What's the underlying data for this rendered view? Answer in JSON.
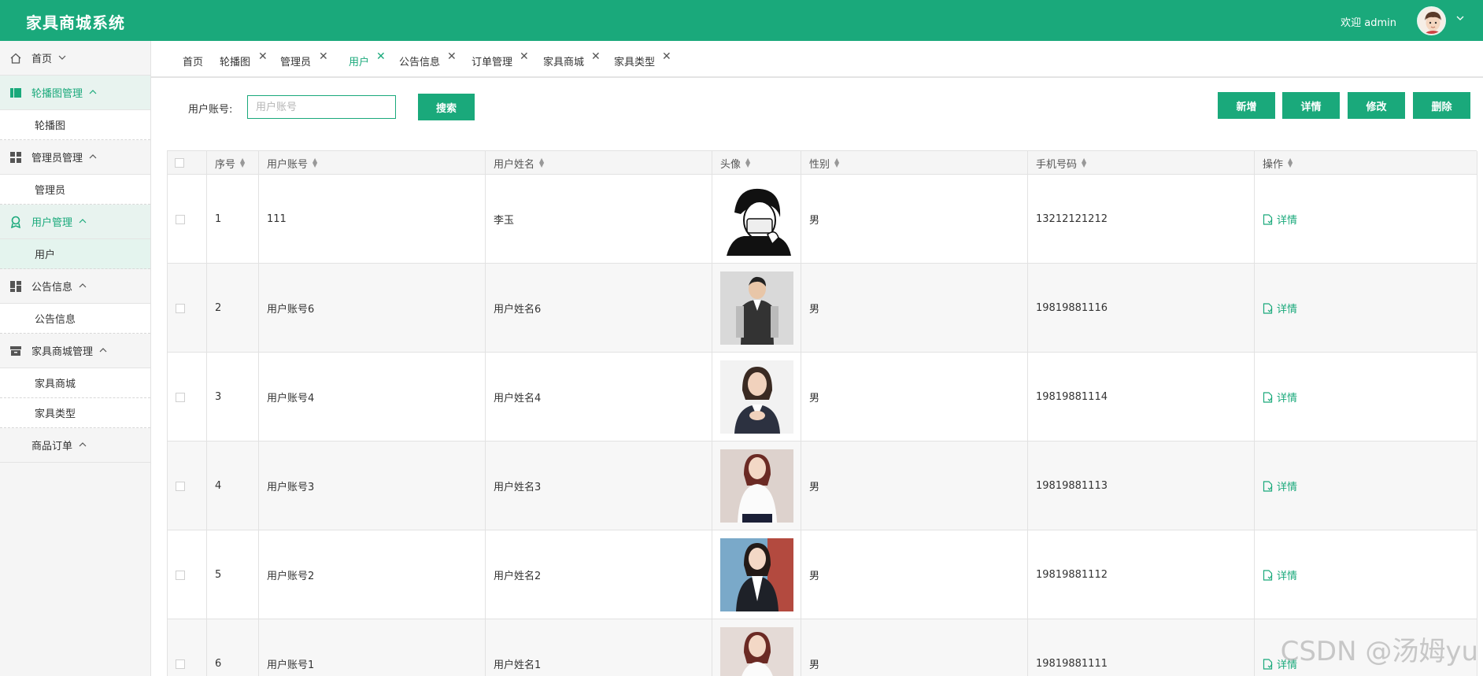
{
  "header": {
    "app_title": "家具商城系统",
    "welcome": "欢迎 admin",
    "accent_color": "#1aa97b"
  },
  "sidebar": {
    "home": "首页",
    "groups": [
      {
        "label": "轮播图管理",
        "icon": "carousel-icon",
        "subs": [
          "轮播图"
        ]
      },
      {
        "label": "管理员管理",
        "icon": "grid-icon",
        "subs": [
          "管理员"
        ]
      },
      {
        "label": "用户管理",
        "icon": "user-icon",
        "subs": [
          "用户"
        ]
      },
      {
        "label": "公告信息",
        "icon": "dashboard-icon",
        "subs": [
          "公告信息"
        ]
      },
      {
        "label": "家具商城管理",
        "icon": "archive-icon",
        "subs": [
          "家具商城",
          "家具类型"
        ]
      },
      {
        "label": "商品订单",
        "icon": "",
        "subs": []
      }
    ]
  },
  "tabs": [
    "首页",
    "轮播图",
    "管理员",
    "用户",
    "公告信息",
    "订单管理",
    "家具商城",
    "家具类型"
  ],
  "search": {
    "label": "用户账号:",
    "placeholder": "用户账号",
    "button": "搜索"
  },
  "actions": {
    "add": "新增",
    "detail": "详情",
    "edit": "修改",
    "delete": "删除"
  },
  "table": {
    "columns": [
      "序号",
      "用户账号",
      "用户姓名",
      "头像",
      "性别",
      "手机号码",
      "操作"
    ],
    "row_action": "详情",
    "rows": [
      {
        "no": "1",
        "account": "111",
        "name": "李玉",
        "gender": "男",
        "phone": "13212121212"
      },
      {
        "no": "2",
        "account": "用户账号6",
        "name": "用户姓名6",
        "gender": "男",
        "phone": "19819881116"
      },
      {
        "no": "3",
        "account": "用户账号4",
        "name": "用户姓名4",
        "gender": "男",
        "phone": "19819881114"
      },
      {
        "no": "4",
        "account": "用户账号3",
        "name": "用户姓名3",
        "gender": "男",
        "phone": "19819881113"
      },
      {
        "no": "5",
        "account": "用户账号2",
        "name": "用户姓名2",
        "gender": "男",
        "phone": "19819881112"
      },
      {
        "no": "6",
        "account": "用户账号1",
        "name": "用户姓名1",
        "gender": "男",
        "phone": "19819881111"
      }
    ]
  },
  "watermark": "CSDN @汤姆yu"
}
